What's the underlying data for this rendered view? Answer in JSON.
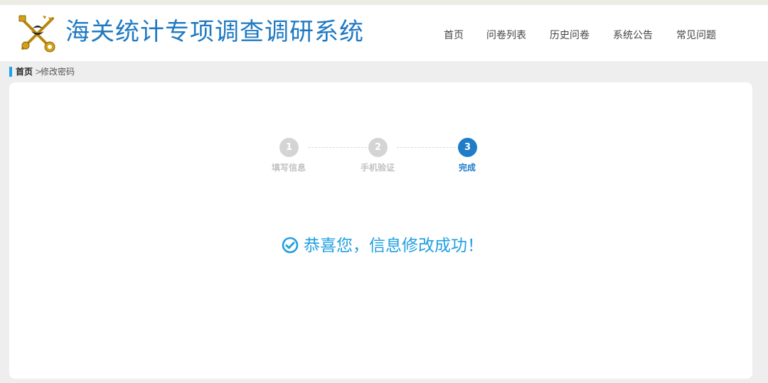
{
  "header": {
    "site_title": "海关统计专项调查调研系统",
    "logo_icon": "customs-emblem-icon"
  },
  "nav": {
    "items": [
      {
        "label": "首页"
      },
      {
        "label": "问卷列表"
      },
      {
        "label": "历史问卷"
      },
      {
        "label": "系统公告"
      },
      {
        "label": "常见问题"
      }
    ]
  },
  "breadcrumb": {
    "home": "首页",
    "separator": ">",
    "current": "修改密码"
  },
  "steps": {
    "items": [
      {
        "number": "1",
        "label": "填写信息"
      },
      {
        "number": "2",
        "label": "手机验证"
      },
      {
        "number": "3",
        "label": "完成"
      }
    ],
    "active_index": 2
  },
  "result": {
    "icon": "check-circle-icon",
    "message": "恭喜您，信息修改成功！"
  },
  "colors": {
    "primary": "#1e7cc8",
    "success_text": "#1f9fe0",
    "accent_bar": "#1aa3e8",
    "inactive_step": "#d4d4d4"
  }
}
